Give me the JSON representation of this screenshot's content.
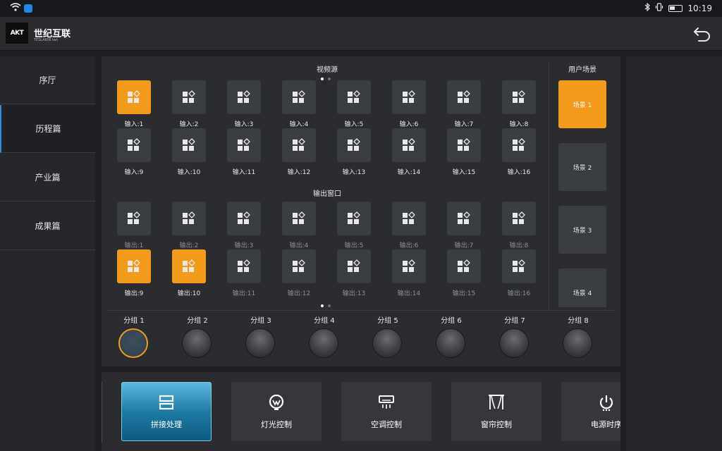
{
  "status": {
    "time": "10:19"
  },
  "header": {
    "logo_text": "AKT",
    "title": "世纪互联",
    "subtitle": "TESLAKIN tan"
  },
  "sidebar": {
    "items": [
      {
        "label": "序厅",
        "active": false
      },
      {
        "label": "历程篇",
        "active": true
      },
      {
        "label": "产业篇",
        "active": false
      },
      {
        "label": "成果篇",
        "active": false
      }
    ]
  },
  "video_sources": {
    "title": "视频源",
    "items": [
      "输入:1",
      "输入:2",
      "输入:3",
      "输入:4",
      "输入:5",
      "输入:6",
      "输入:7",
      "输入:8",
      "输入:9",
      "输入:10",
      "输入:11",
      "输入:12",
      "输入:13",
      "输入:14",
      "输入:15",
      "输入:16"
    ],
    "active": [
      0
    ]
  },
  "outputs": {
    "title": "输出窗口",
    "items": [
      "输出:1",
      "输出:2",
      "输出:3",
      "输出:4",
      "输出:5",
      "输出:6",
      "输出:7",
      "输出:8",
      "输出:9",
      "输出:10",
      "输出:11",
      "输出:12",
      "输出:13",
      "输出:14",
      "输出:15",
      "输出:16"
    ],
    "active": [
      8,
      9
    ]
  },
  "scenes": {
    "title": "用户场景",
    "items": [
      "场景 1",
      "场景 2",
      "场景 3",
      "场景 4"
    ],
    "active": 0
  },
  "groups": {
    "items": [
      "分组 1",
      "分组 2",
      "分组 3",
      "分组 4",
      "分组 5",
      "分组 6",
      "分组 7",
      "分组 8"
    ],
    "active": 0
  },
  "functions": {
    "items": [
      {
        "label": "拼接处理",
        "icon": "splice-icon",
        "active": true
      },
      {
        "label": "灯光控制",
        "icon": "light-icon",
        "active": false
      },
      {
        "label": "空调控制",
        "icon": "aircon-icon",
        "active": false
      },
      {
        "label": "窗帘控制",
        "icon": "curtain-icon",
        "active": false
      },
      {
        "label": "电源时序",
        "icon": "power-icon",
        "active": false
      }
    ]
  },
  "colors": {
    "accent": "#f39a1a",
    "active_blue": "#1d7ba5",
    "sidebar_indicator": "#2f8bd8"
  }
}
